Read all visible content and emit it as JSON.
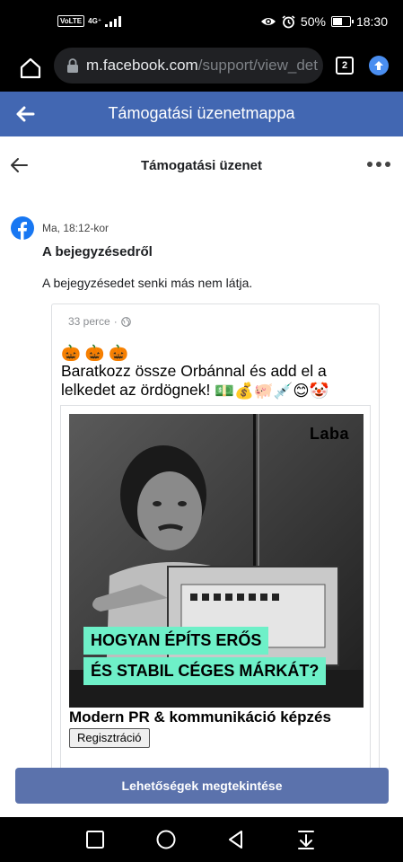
{
  "status_bar": {
    "volte": "VoLTE",
    "network": "4G⁺",
    "battery_percent": "50%",
    "battery_level": 0.5,
    "time": "18:30"
  },
  "browser": {
    "url_host": "m.facebook.com",
    "url_path": "/support/view_det",
    "tab_count": "2"
  },
  "fb_header": {
    "title": "Támogatási üzenetmappa"
  },
  "sub_header": {
    "title": "Támogatási üzenet"
  },
  "message": {
    "time": "Ma, 18:12-kor",
    "title": "A bejegyzésedről",
    "body": "A bejegyzésedet senki más nem látja."
  },
  "post": {
    "time": "33 perce",
    "separator": "·",
    "pumpkins": "🎃 🎃 🎃",
    "text": "Baratkozz össze Orbánnal és add el a lelkedet az ördögnek!",
    "emojis": "💵💰🐖💉😊🤡",
    "ad": {
      "brand": "Laba",
      "banner_line1": "HOGYAN ÉPÍTS ERŐS",
      "banner_line2": "ÉS STABIL CÉGES MÁRKÁT?",
      "headline": "Modern PR & kommunikáció képzés",
      "cta": "Regisztráció"
    }
  },
  "actions": {
    "options_button": "Lehetőségek megtekintése"
  },
  "colors": {
    "fb_blue": "#4267b2",
    "button_blue": "#5b72ac",
    "banner_mint": "#6ef0c8"
  }
}
